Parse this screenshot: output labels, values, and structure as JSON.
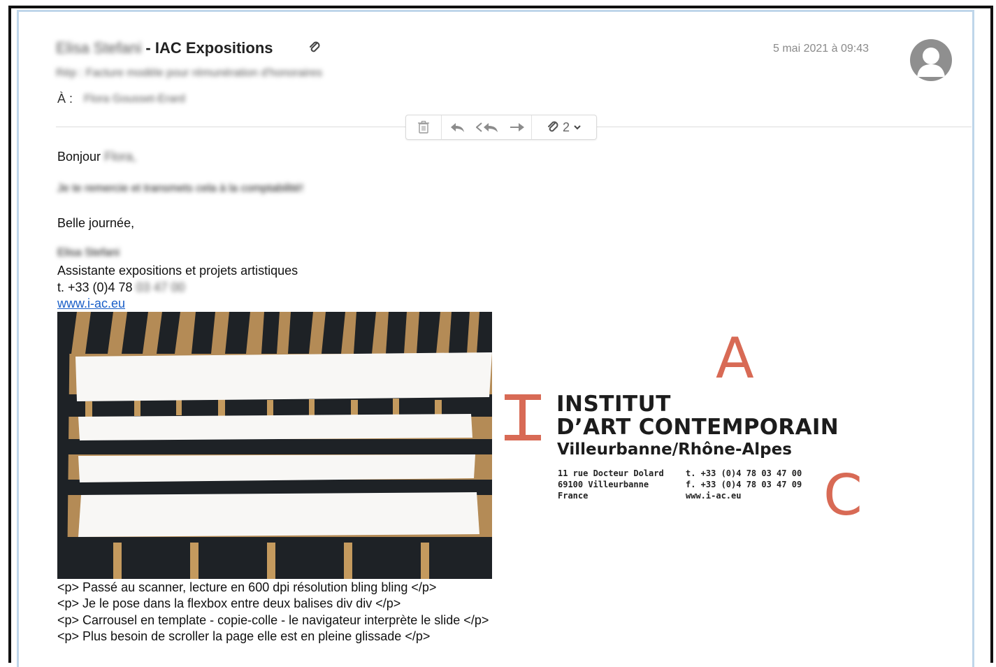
{
  "header": {
    "sender_name": "Elisa Stefani",
    "sender_org": " - IAC Expositions",
    "date": "5 mai 2021 à 09:43",
    "subject": "Rép : Facture modèle pour rémunération d'honoraires",
    "to_label": "À :",
    "to_value": "Flora Gousset-Erard"
  },
  "toolbar": {
    "attachment_count": "2",
    "icons": [
      "trash-icon",
      "reply-icon",
      "reply-all-icon",
      "forward-icon",
      "paperclip-icon",
      "chevron-down-icon"
    ]
  },
  "body": {
    "greeting": "Bonjour",
    "greeting_name": "Flora,",
    "message": "Je te remercie et transmets cela à la comptabilité!",
    "closing": "Belle journée,",
    "signature_name": "Elisa Stefani",
    "signature_title": "Assistante expositions et projets artistiques",
    "phone_prefix": "t. +33 (0)4 78",
    "phone_rest": "03 47 00",
    "website": "www.i-ac.eu"
  },
  "logo": {
    "letter_a": "A",
    "letter_c": "C",
    "line1": "INSTITUT",
    "line2": "D’ART CONTEMPORAIN",
    "line3": "Villeurbanne/Rhône-Alpes",
    "address1": "11 rue Docteur Dolard",
    "address2": "69100 Villeurbanne",
    "address3": "France",
    "tel": "t.  +33 (0)4 78 03 47 00",
    "fax": "f.  +33 (0)4 78 03 47 09",
    "web": "www.i-ac.eu",
    "brand_color": "#d86a55"
  },
  "code_lines": [
    "<p> Passé au scanner, lecture en 600 dpi résolution bling bling </p>",
    "<p> Je le pose dans la flexbox entre deux balises div div </p>",
    "<p> Carrousel en template - copie-colle - le navigateur interprète le slide </p>",
    "<p> Plus besoin de scroller la page elle est en pleine glissade </p>"
  ]
}
